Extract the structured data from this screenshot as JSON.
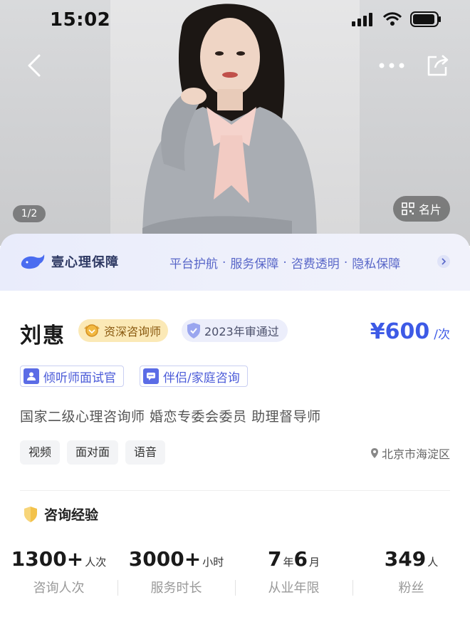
{
  "status_bar": {
    "time": "15:02"
  },
  "hero": {
    "photo_counter": "1/2",
    "card_button_label": "名片"
  },
  "banner": {
    "brand": "壹心理保障",
    "tags": [
      "平台护航",
      "服务保障",
      "咨费透明",
      "隐私保障"
    ],
    "separator": "·"
  },
  "profile": {
    "name": "刘惠",
    "level_badge": "资深咨询师",
    "review_badge": "2023年审通过",
    "price": {
      "amount": "¥600",
      "unit": "/次"
    },
    "roles": [
      "倾听师面试官",
      "伴侣/家庭咨询"
    ],
    "titles": "国家二级心理咨询师 婚恋专委会委员 助理督导师",
    "modes": [
      "视频",
      "面对面",
      "语音"
    ],
    "location": "北京市海淀区"
  },
  "experience": {
    "title": "咨询经验",
    "stats": [
      {
        "value": "1300+",
        "unit": "人次",
        "label": "咨询人次"
      },
      {
        "value": "3000+",
        "unit": "小时",
        "label": "服务时长"
      },
      {
        "value": "7",
        "unit": "年",
        "value2": "6",
        "unit2": "月",
        "label": "从业年限"
      },
      {
        "value": "349",
        "unit": "人",
        "label": "粉丝"
      }
    ]
  },
  "colors": {
    "accent": "#3d5ae6",
    "gold_badge": "#fbe9b6",
    "banner": "#eceefb"
  },
  "icons": [
    "back-icon",
    "more-icon",
    "share-icon",
    "qr-icon",
    "whale-icon",
    "shield-icon",
    "person-icon",
    "chat-icon",
    "location-pin-icon",
    "experience-shield-icon"
  ]
}
